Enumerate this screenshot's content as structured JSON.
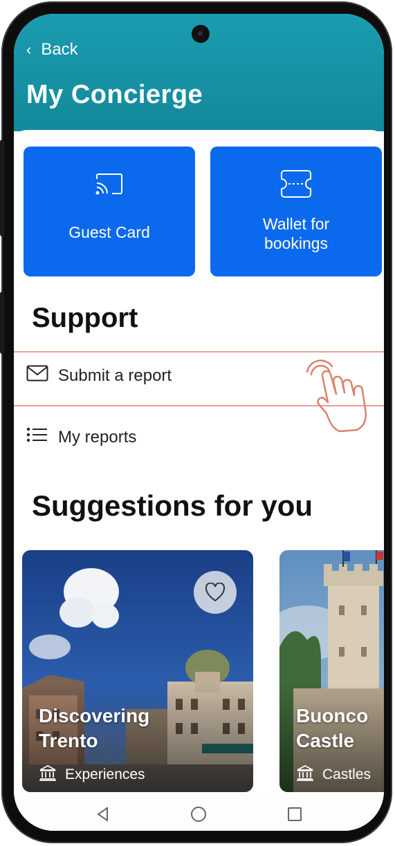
{
  "header": {
    "back_label": "Back",
    "title": "My Concierge",
    "color": "#1595a8"
  },
  "tiles": [
    {
      "label": "Guest Card",
      "icon": "cast-icon"
    },
    {
      "label": "Wallet for\nbookings",
      "icon": "ticket-icon"
    }
  ],
  "support": {
    "title": "Support",
    "items": [
      {
        "label": "Submit a report",
        "icon": "mail-icon"
      },
      {
        "label": "My reports",
        "icon": "list-icon"
      }
    ]
  },
  "suggestions": {
    "title": "Suggestions for you",
    "cards": [
      {
        "title": "Discovering\nTrento",
        "category": "Experiences",
        "category_icon": "museum-icon"
      },
      {
        "title": "Buonco\nCastle",
        "category": "Castles",
        "category_icon": "museum-icon"
      }
    ]
  },
  "navbar": {
    "icons": [
      "back-triangle-icon",
      "home-circle-icon",
      "recents-square-icon"
    ]
  },
  "colors": {
    "accent": "#0b69ee",
    "highlight_line": "#e5a190"
  }
}
